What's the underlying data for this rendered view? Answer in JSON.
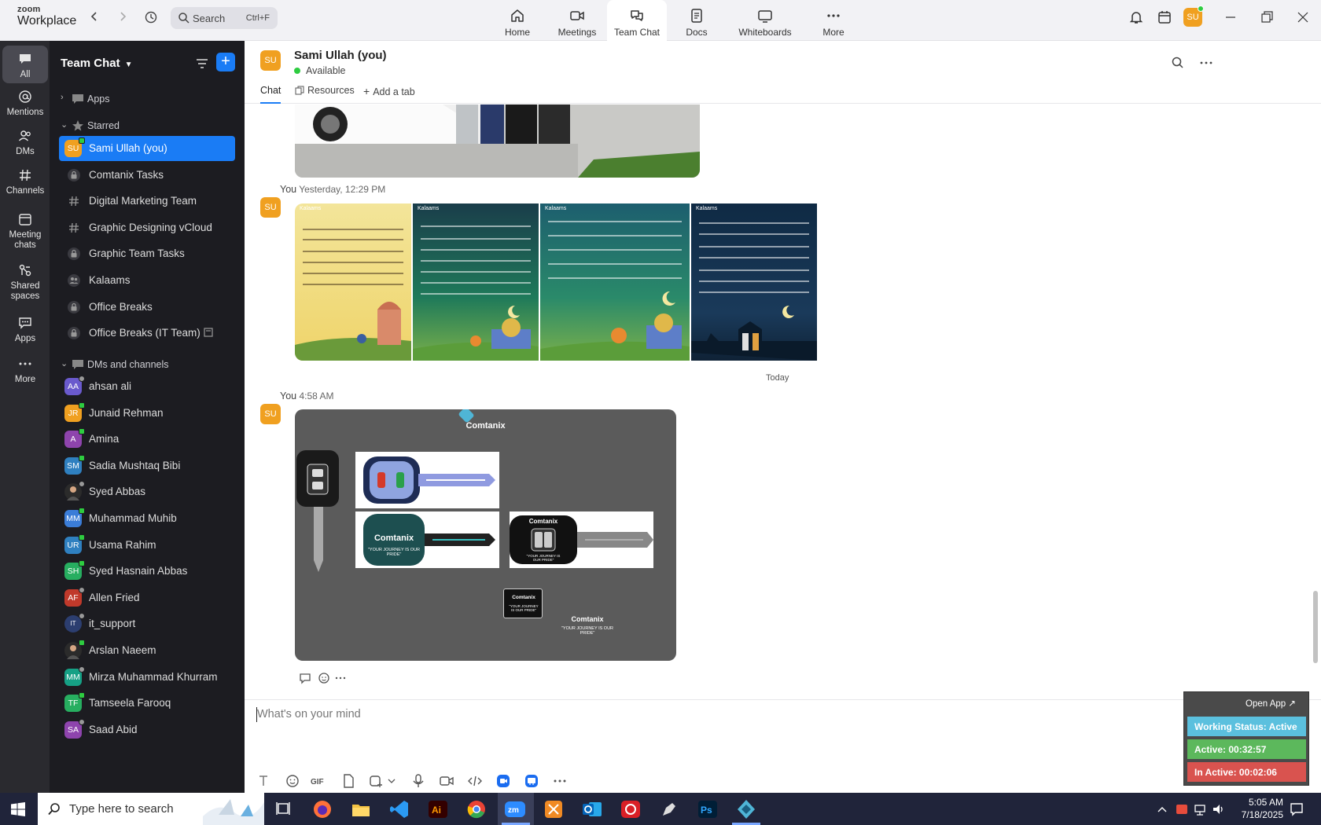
{
  "app": {
    "logo_top": "zoom",
    "logo_bottom": "Workplace",
    "search_label": "Search",
    "search_shortcut": "Ctrl+F",
    "user_initials": "SU"
  },
  "topnav": [
    {
      "label": "Home",
      "icon": "home-icon"
    },
    {
      "label": "Meetings",
      "icon": "video-camera-icon"
    },
    {
      "label": "Team Chat",
      "icon": "chat-bubbles-icon",
      "active": true
    },
    {
      "label": "Docs",
      "icon": "document-icon"
    },
    {
      "label": "Whiteboards",
      "icon": "whiteboard-icon"
    },
    {
      "label": "More",
      "icon": "more-dots-icon"
    }
  ],
  "rail": [
    {
      "label": "All",
      "icon": "chat-icon",
      "active": true
    },
    {
      "label": "Mentions",
      "icon": "at-sign-icon"
    },
    {
      "label": "DMs",
      "icon": "people-icon"
    },
    {
      "label": "Channels",
      "icon": "hash-icon"
    },
    {
      "label1": "Meeting",
      "label2": "chats",
      "icon": "calendar-icon"
    },
    {
      "label1": "Shared",
      "label2": "spaces",
      "icon": "shared-spaces-icon"
    },
    {
      "label": "Apps",
      "icon": "apps-icon"
    },
    {
      "label": "More",
      "icon": "more-dots-icon"
    }
  ],
  "sidebar": {
    "title": "Team Chat",
    "sections": {
      "apps": "Apps",
      "starred": "Starred",
      "dms": "DMs and channels"
    },
    "starred": [
      {
        "label": "Sami Ullah (you)",
        "type": "avatar",
        "initials": "SU",
        "color": "#f0a020",
        "active": true
      },
      {
        "label": "Comtanix Tasks",
        "type": "lock"
      },
      {
        "label": "Digital Marketing Team",
        "type": "hash"
      },
      {
        "label": "Graphic Designing vCloud",
        "type": "hash"
      },
      {
        "label": "Graphic Team Tasks",
        "type": "lock"
      },
      {
        "label": "Kalaams",
        "type": "people"
      },
      {
        "label": "Office Breaks",
        "type": "lock"
      },
      {
        "label": "Office Breaks (IT Team)",
        "type": "lock"
      }
    ],
    "dms": [
      {
        "label": "ahsan ali",
        "initials": "AA",
        "color": "#6a5acd"
      },
      {
        "label": "Junaid Rehman",
        "initials": "JR",
        "color": "#f0a020",
        "online": true
      },
      {
        "label": "Amina",
        "initials": "A",
        "color": "#8e44ad",
        "online": true
      },
      {
        "label": "Sadia Mushtaq Bibi",
        "initials": "SM",
        "color": "#2f80c0",
        "online": true
      },
      {
        "label": "Syed Abbas",
        "initials": "",
        "color": "#333",
        "photo": true
      },
      {
        "label": "Muhammad Muhib",
        "initials": "MM",
        "color": "#3b7dd8",
        "online": true
      },
      {
        "label": "Usama Rahim",
        "initials": "UR",
        "color": "#2f80c0",
        "online": true
      },
      {
        "label": "Syed Hasnain Abbas",
        "initials": "SH",
        "color": "#27ae60",
        "online": true
      },
      {
        "label": "Allen Fried",
        "initials": "AF",
        "color": "#c0392b"
      },
      {
        "label": "it_support",
        "initials": "IT",
        "color": "#2c3e70",
        "logo": true
      },
      {
        "label": "Arslan Naeem",
        "initials": "",
        "color": "#333",
        "photo": true,
        "online": true
      },
      {
        "label": "Mirza Muhammad Khurram",
        "initials": "MM",
        "color": "#16a085"
      },
      {
        "label": "Tamseela Farooq",
        "initials": "TF",
        "color": "#27ae60",
        "online": true
      },
      {
        "label": "Saad Abid",
        "initials": "SA",
        "color": "#8e44ad"
      }
    ]
  },
  "chat": {
    "name": "Sami Ullah (you)",
    "initials": "SU",
    "status": "Available",
    "tabs": [
      "Chat",
      "Resources",
      "Add a tab"
    ],
    "messages": [
      {
        "sender": "You",
        "time": "Yesterday, 12:29 PM"
      },
      {
        "sender": "You",
        "time": "4:58 AM"
      }
    ],
    "today_label": "Today",
    "poster_brand": "Kalaams",
    "keys_brand": "Comtanix",
    "keys_tagline": "\"YOUR JOURNEY IS OUR PRIDE\"",
    "composer_placeholder": "What's on your mind"
  },
  "widget": {
    "open_app": "Open App ↗",
    "working_status": "Working Status: Active",
    "active": "Active: 00:32:57",
    "inactive": "In Active: 00:02:06",
    "colors": {
      "status": "#5bc0de",
      "active": "#5cb85c",
      "inactive": "#d9534f"
    }
  },
  "taskbar": {
    "search_placeholder": "Type here to search",
    "time": "5:05 AM",
    "date": "7/18/2025"
  }
}
